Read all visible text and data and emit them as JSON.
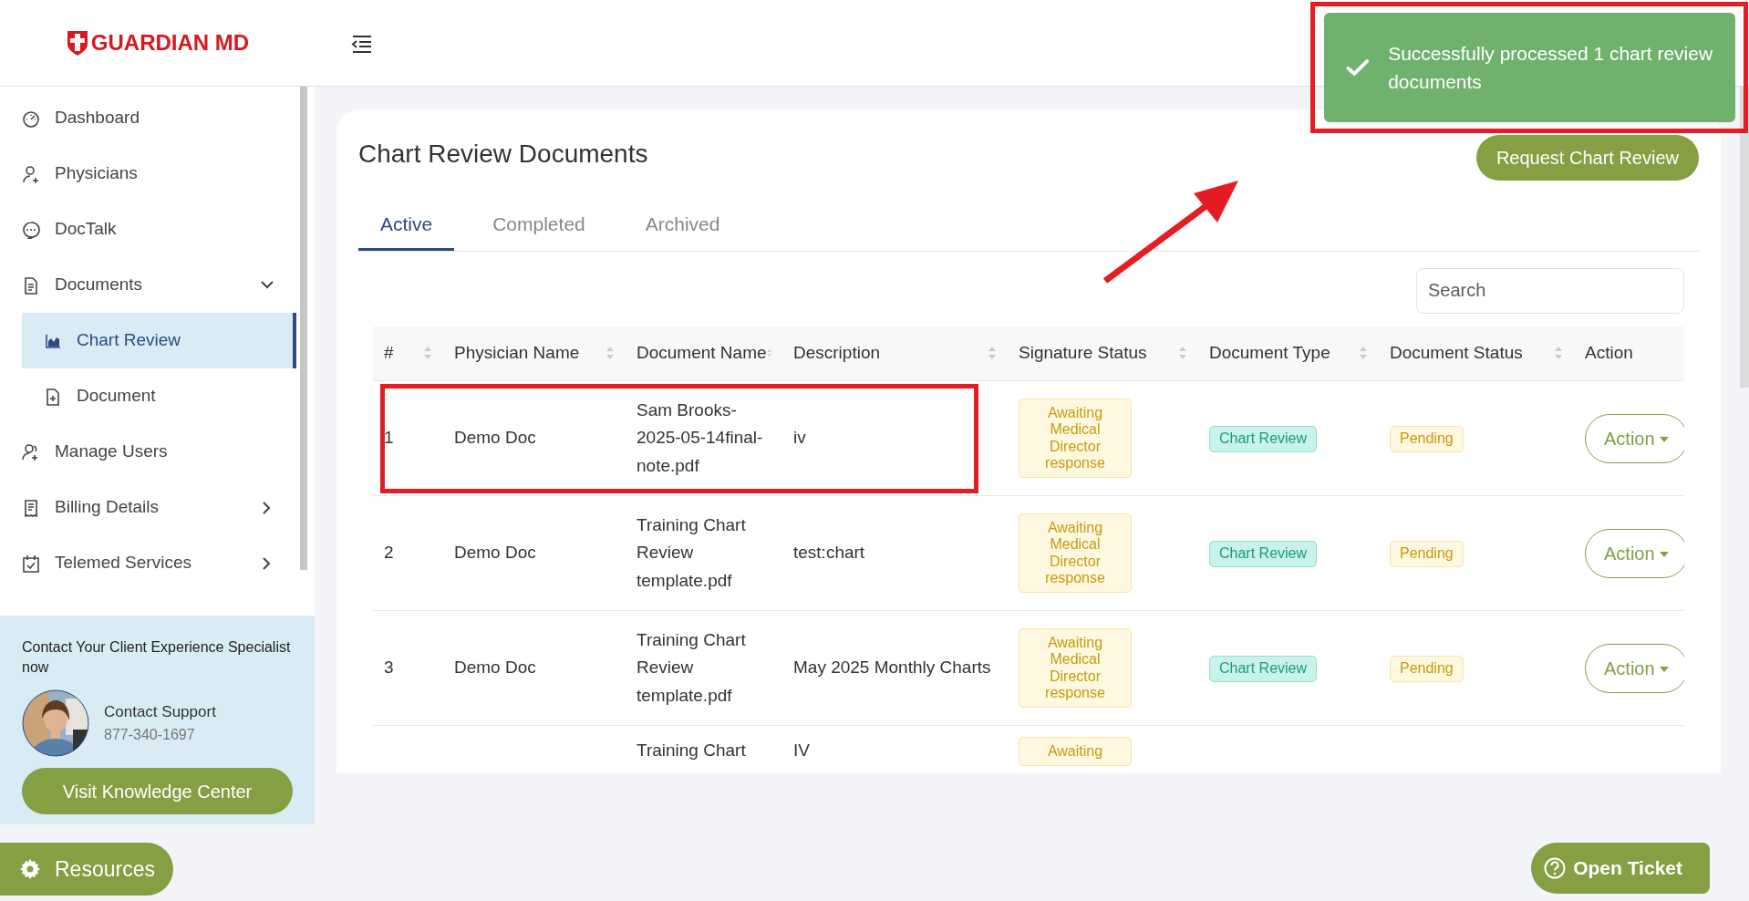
{
  "brand": "GUARDIAN MD",
  "toast": {
    "message": "Successfully processed 1 chart review documents"
  },
  "sidebar": {
    "items": [
      {
        "label": "Dashboard",
        "selected": false
      },
      {
        "label": "Physicians",
        "selected": false
      },
      {
        "label": "DocTalk",
        "selected": false
      },
      {
        "label": "Documents",
        "selected": false,
        "expanded": true,
        "children": [
          {
            "label": "Chart Review",
            "selected": true
          },
          {
            "label": "Document",
            "selected": false
          }
        ]
      },
      {
        "label": "Manage Users",
        "selected": false
      },
      {
        "label": "Billing Details",
        "selected": false,
        "expanded": false
      },
      {
        "label": "Telemed Services",
        "selected": false,
        "expanded": false
      }
    ],
    "contact": {
      "heading": "Contact Your Client Experience Specialist now",
      "name": "Contact Support",
      "phone": "877-340-1697",
      "button": "Visit Knowledge Center"
    },
    "resources_button": "Resources"
  },
  "page": {
    "title": "Chart Review Documents",
    "request_button": "Request Chart Review",
    "tabs": [
      {
        "label": "Active",
        "selected": true
      },
      {
        "label": "Completed",
        "selected": false
      },
      {
        "label": "Archived",
        "selected": false
      }
    ],
    "search": {
      "placeholder": "Search"
    }
  },
  "table": {
    "columns": [
      {
        "label": "#",
        "sortable": true
      },
      {
        "label": "Physician Name",
        "sortable": true
      },
      {
        "label": "Document Name",
        "sortable": true
      },
      {
        "label": "Description",
        "sortable": true
      },
      {
        "label": "Signature Status",
        "sortable": true
      },
      {
        "label": "Document Type",
        "sortable": true
      },
      {
        "label": "Document Status",
        "sortable": true
      },
      {
        "label": "Action",
        "sortable": false
      }
    ],
    "rows": [
      {
        "number": "1",
        "physician": "Demo Doc",
        "document": "Sam Brooks-2025-05-14final-note.pdf",
        "description": "iv",
        "signature_status": "Awaiting Medical Director response",
        "document_type": "Chart Review",
        "document_status": "Pending",
        "action": "Action"
      },
      {
        "number": "2",
        "physician": "Demo Doc",
        "document": "Training Chart Review template.pdf",
        "description": "test:chart",
        "signature_status": "Awaiting Medical Director response",
        "document_type": "Chart Review",
        "document_status": "Pending",
        "action": "Action"
      },
      {
        "number": "3",
        "physician": "Demo Doc",
        "document": "Training Chart Review template.pdf",
        "description": "May 2025 Monthly Charts",
        "signature_status": "Awaiting Medical Director response",
        "document_type": "Chart Review",
        "document_status": "Pending",
        "action": "Action"
      },
      {
        "document": "Training Chart",
        "description": "IV",
        "signature_status": "Awaiting"
      }
    ]
  },
  "help_button": "Open Ticket",
  "annotations": [
    {
      "kind": "toast-frame"
    },
    {
      "kind": "row-frame"
    },
    {
      "kind": "arrow"
    }
  ]
}
